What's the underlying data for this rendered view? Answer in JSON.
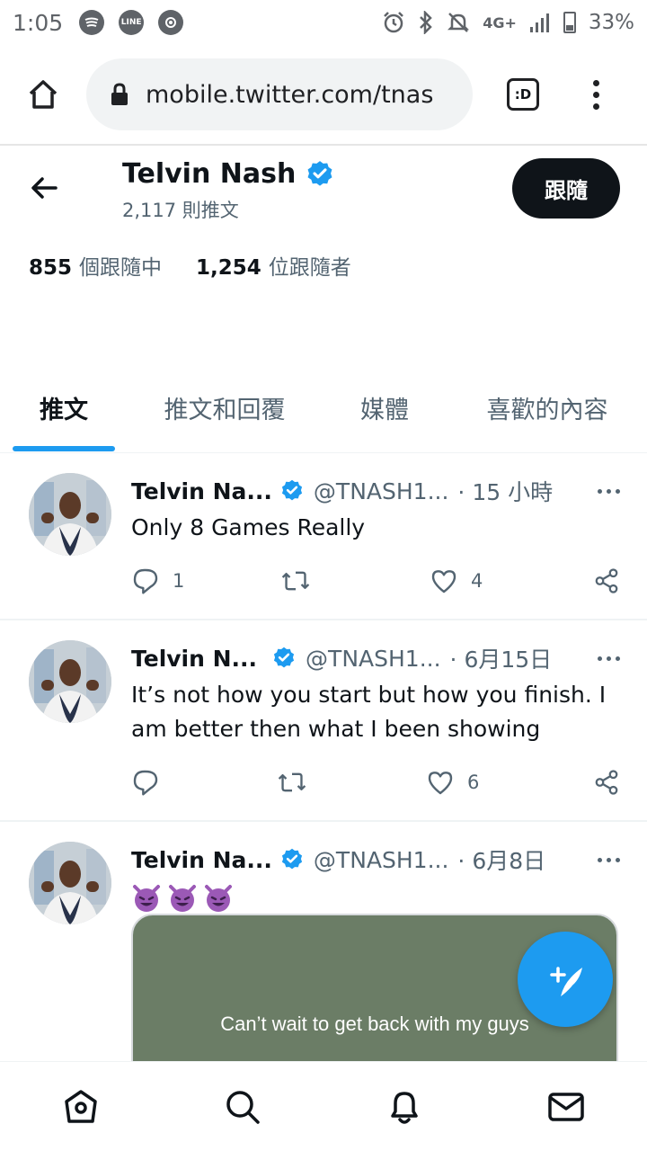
{
  "status_bar": {
    "time": "1:05",
    "battery": "33%",
    "network": "4G+",
    "icons": [
      "spotify-icon",
      "line-icon",
      "camera-icon",
      "alarm-icon",
      "bluetooth-icon",
      "mute-icon",
      "signal-icon",
      "battery-icon"
    ],
    "line_badge": "LINE"
  },
  "browser": {
    "url": "mobile.twitter.com/tnas",
    "tab_badge": ":D"
  },
  "profile": {
    "name": "Telvin Nash",
    "tweet_count": "2,117 則推文",
    "follow_button": "跟隨",
    "following_count": "855",
    "following_label": "個跟隨中",
    "followers_count": "1,254",
    "followers_label": "位跟隨者"
  },
  "tabs": [
    {
      "label": "推文",
      "active": true
    },
    {
      "label": "推文和回覆",
      "active": false
    },
    {
      "label": "媒體",
      "active": false
    },
    {
      "label": "喜歡的內容",
      "active": false
    }
  ],
  "tweets": [
    {
      "name": "Telvin Na...",
      "handle": "@TNASH1...",
      "time": "· 15 小時",
      "text": "Only 8 Games Really",
      "replies": "1",
      "retweets": "",
      "likes": "4"
    },
    {
      "name": "Telvin N...",
      "handle": "@TNASH1...",
      "time": "· 6月15日",
      "text": "It’s not how you start but how you finish.  I am better then what I been showing",
      "replies": "",
      "retweets": "",
      "likes": "6"
    },
    {
      "name": "Telvin Na...",
      "handle": "@TNASH1...",
      "time": "· 6月8日",
      "text": "",
      "emojis": [
        "😈",
        "😈",
        "😈"
      ],
      "media_caption": "Can’t wait to get back with my  guys"
    }
  ],
  "colors": {
    "accent": "#1d9bf0",
    "text_primary": "#0f1419",
    "text_secondary": "#536471",
    "follow_button_bg": "#0f1419",
    "media_bg": "#6b7d66"
  },
  "bottom_nav": [
    "home-icon",
    "search-icon",
    "notifications-icon",
    "messages-icon"
  ]
}
